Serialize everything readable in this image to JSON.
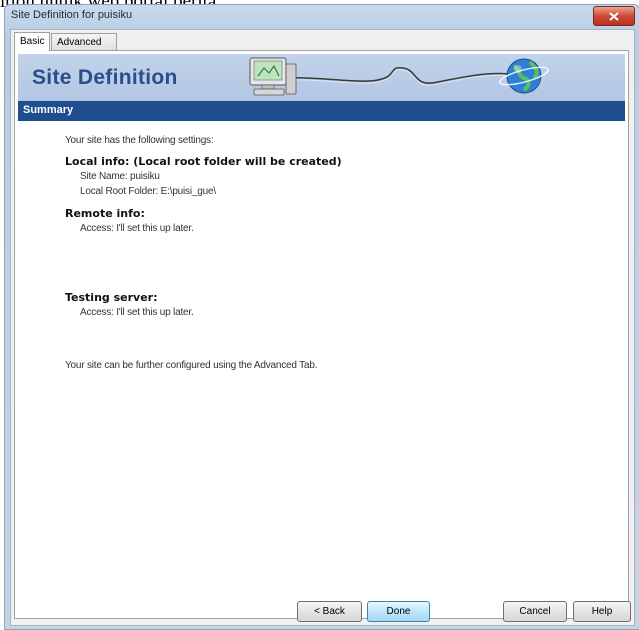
{
  "background_caption": "ition untuk web portal berita.",
  "window": {
    "title": "Site Definition for puisiku",
    "close_glyph": "x"
  },
  "tabs": [
    {
      "label": "Basic",
      "active": true
    },
    {
      "label": "Advanced",
      "active": false
    }
  ],
  "banner": {
    "title": "Site Definition",
    "icons": [
      "computer-icon",
      "globe-icon"
    ]
  },
  "summary": {
    "header": "Summary",
    "intro": "Your site has the following settings:",
    "local_heading": "Local info: (Local root folder will be created)",
    "site_name": "Site Name: puisiku",
    "local_root": "Local Root Folder: E:\\puisi_gue\\",
    "remote_heading": "Remote info:",
    "remote_access": "Access: I'll set this up later.",
    "testing_heading": "Testing server:",
    "testing_access": "Access: I'll set this up later.",
    "footer_note": "Your site can be further configured using the Advanced Tab."
  },
  "buttons": {
    "back": "< Back",
    "done": "Done",
    "cancel": "Cancel",
    "help": "Help"
  },
  "colors": {
    "banner": "#b9cce6",
    "summary_bar": "#1f4e8f",
    "banner_title": "#2a4e8c"
  }
}
